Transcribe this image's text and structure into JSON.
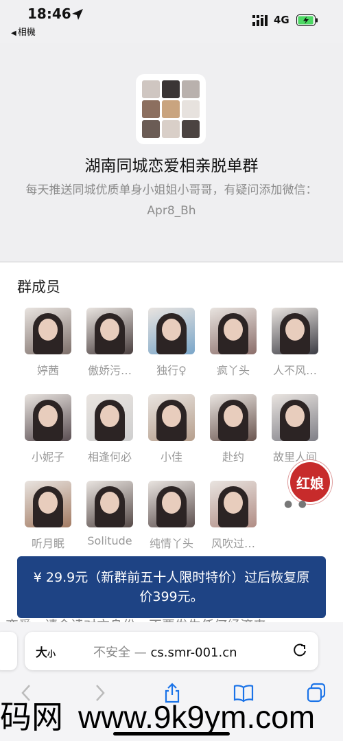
{
  "status_bar": {
    "time": "18:46",
    "back_app": "相機",
    "network": "4G",
    "icons": [
      "location-arrow-icon",
      "signal-bars-icon",
      "battery-charging-icon"
    ]
  },
  "group": {
    "title": "湖南同城恋爱相亲脱单群",
    "description": "每天推送同城优质单身小姐姐小哥哥，有疑问添加微信：Apr8_Bh"
  },
  "members": {
    "title": "群成员",
    "list": [
      {
        "name": "婷茜",
        "tone": "#7d6f6a"
      },
      {
        "name": "傲娇污…",
        "tone": "#4a3f3f"
      },
      {
        "name": "独行♀",
        "tone": "#7aa6c9"
      },
      {
        "name": "疯丫头",
        "tone": "#8b6e6a"
      },
      {
        "name": "人不风…",
        "tone": "#3c3c44"
      },
      {
        "name": "小妮子",
        "tone": "#5a4e52"
      },
      {
        "name": "相逢何必",
        "tone": "#cfcfcf"
      },
      {
        "name": "小佳",
        "tone": "#b69f8d"
      },
      {
        "name": "赴约",
        "tone": "#6b5650"
      },
      {
        "name": "故里人间",
        "tone": "#7f7f87"
      },
      {
        "name": "听月眠",
        "tone": "#a27a62"
      },
      {
        "name": "Solitude",
        "tone": "#564a48"
      },
      {
        "name": "纯情丫头",
        "tone": "#5c4f4e"
      },
      {
        "name": "风吹过…",
        "tone": "#b18d85"
      }
    ]
  },
  "badge": {
    "label": "红娘",
    "color": "#c72b2b"
  },
  "promo": {
    "text": "¥ 29.9元（新群前五十人限时特价）过后恢复原价399元。",
    "color": "#1e4384"
  },
  "under_text": "恋爱，请今读对方身份，不要发生任何经济来",
  "browser": {
    "text_size_label": "大",
    "text_size_small": "小",
    "insecure_label": "不安全 —",
    "url": "cs.smr-001.cn",
    "icons": [
      "reload-icon",
      "back-arrow-icon",
      "forward-arrow-icon",
      "share-icon",
      "bookmarks-icon",
      "tabs-icon"
    ]
  },
  "watermark": {
    "left": "码网",
    "right": "www.9k9ym.com"
  }
}
